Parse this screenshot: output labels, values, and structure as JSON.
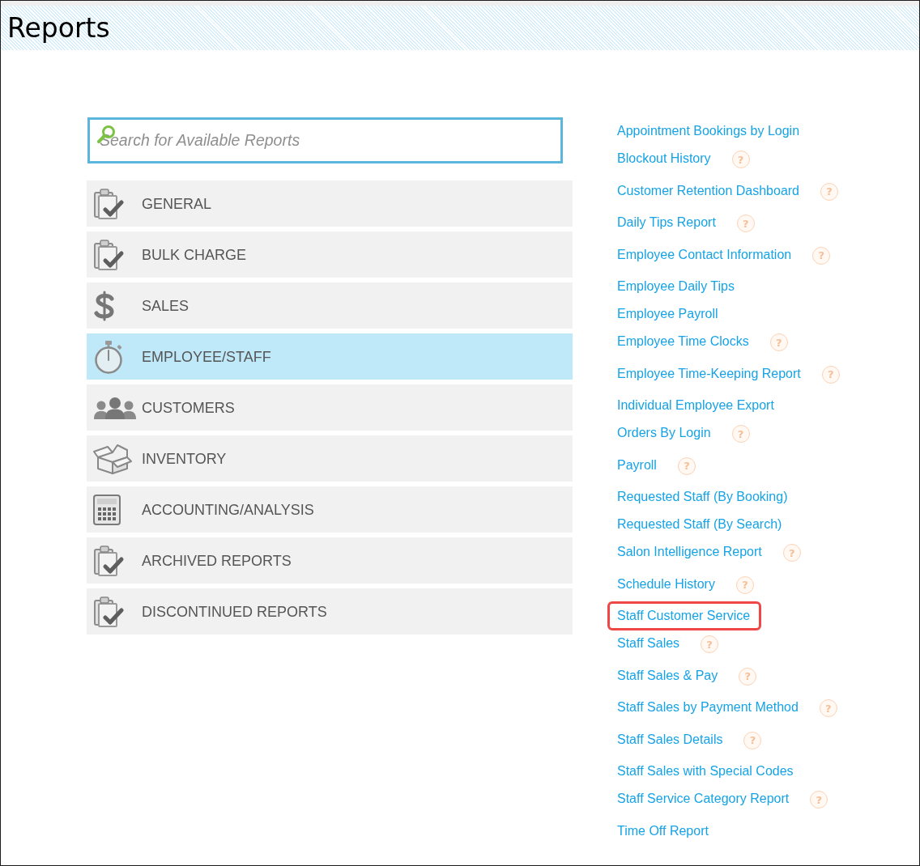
{
  "header": {
    "title": "Reports"
  },
  "search": {
    "placeholder": "Search for Available Reports"
  },
  "categories": [
    {
      "label": "GENERAL",
      "selected": false
    },
    {
      "label": "BULK CHARGE",
      "selected": false
    },
    {
      "label": "SALES",
      "selected": false
    },
    {
      "label": "EMPLOYEE/STAFF",
      "selected": true
    },
    {
      "label": "CUSTOMERS",
      "selected": false
    },
    {
      "label": "INVENTORY",
      "selected": false
    },
    {
      "label": "ACCOUNTING/ANALYSIS",
      "selected": false
    },
    {
      "label": "ARCHIVED REPORTS",
      "selected": false
    },
    {
      "label": "DISCONTINUED REPORTS",
      "selected": false
    }
  ],
  "reports": [
    {
      "label": "Appointment Bookings by Login",
      "highlighted": false
    },
    {
      "label": "Blockout History",
      "help": "?",
      "highlighted": false
    },
    {
      "label": "Customer Retention Dashboard",
      "help": "?",
      "highlighted": false
    },
    {
      "label": "Daily Tips Report",
      "help": "?",
      "highlighted": false
    },
    {
      "label": "Employee Contact Information",
      "help": "?",
      "highlighted": false
    },
    {
      "label": "Employee Daily Tips",
      "highlighted": false
    },
    {
      "label": "Employee Payroll",
      "highlighted": false
    },
    {
      "label": "Employee Time Clocks",
      "help": "?",
      "highlighted": false
    },
    {
      "label": "Employee Time-Keeping Report",
      "help": "?",
      "highlighted": false
    },
    {
      "label": "Individual Employee Export",
      "highlighted": false
    },
    {
      "label": "Orders By Login",
      "help": "?",
      "highlighted": false
    },
    {
      "label": "Payroll",
      "help": "?",
      "highlighted": false
    },
    {
      "label": "Requested Staff (By Booking)",
      "highlighted": false
    },
    {
      "label": "Requested Staff (By Search)",
      "highlighted": false
    },
    {
      "label": "Salon Intelligence Report",
      "help": "?",
      "highlighted": false
    },
    {
      "label": "Schedule History",
      "help": "?",
      "highlighted": false
    },
    {
      "label": "Staff Customer Service",
      "highlighted": true
    },
    {
      "label": "Staff Sales",
      "help": "?",
      "highlighted": false
    },
    {
      "label": "Staff Sales & Pay",
      "help": "?",
      "highlighted": false
    },
    {
      "label": "Staff Sales by Payment Method",
      "help": "?",
      "highlighted": false
    },
    {
      "label": "Staff Sales Details",
      "help": "?",
      "highlighted": false
    },
    {
      "label": "Staff Sales with Special Codes",
      "highlighted": false
    },
    {
      "label": "Staff Service Category Report",
      "help": "?",
      "highlighted": false
    },
    {
      "label": "Time Off Report",
      "highlighted": false
    }
  ]
}
